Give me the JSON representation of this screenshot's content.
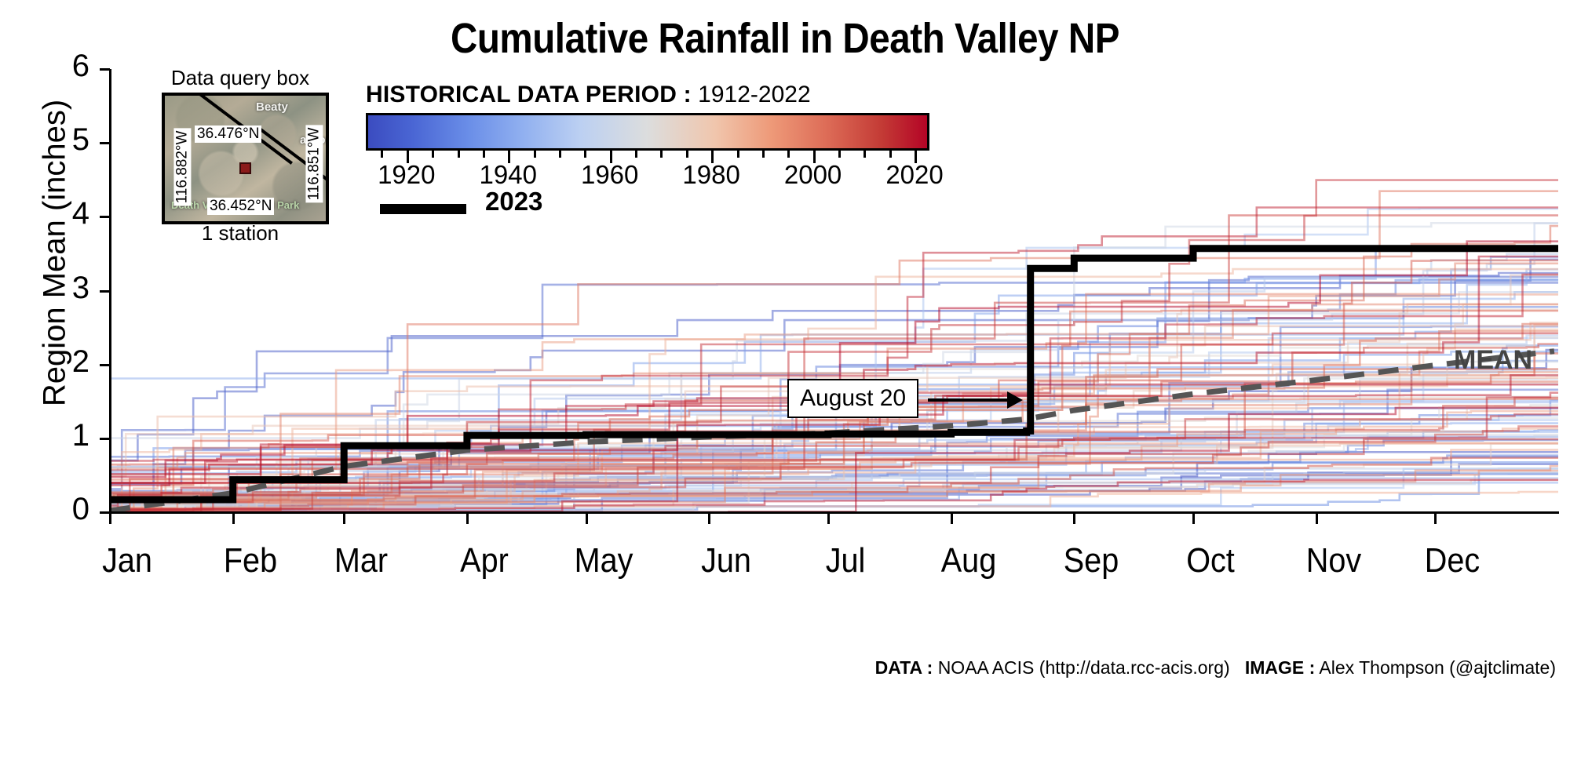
{
  "title": "Cumulative Rainfall in Death Valley NP",
  "axes": {
    "ylabel": "Region Mean (inches)",
    "yticks": [
      "0",
      "1",
      "2",
      "3",
      "4",
      "5",
      "6"
    ],
    "xticks": [
      "Jan",
      "Feb",
      "Mar",
      "Apr",
      "May",
      "Jun",
      "Jul",
      "Aug",
      "Sep",
      "Oct",
      "Nov",
      "Dec"
    ]
  },
  "inset": {
    "title": "Data query box",
    "caption": "1 station",
    "north_label": "36.476°N",
    "south_label": "36.452°N",
    "west_label": "116.882°W",
    "east_label": "116.851°W",
    "places": [
      "Beaty",
      "argosa"
    ],
    "park_label": "Death Valley National Park"
  },
  "legend": {
    "colorbar_title": "HISTORICAL DATA PERIOD :",
    "period": "1912-2022",
    "ticks": [
      "1920",
      "1940",
      "1960",
      "1980",
      "2000",
      "2020"
    ],
    "current_year_label": "2023",
    "mean_label": "MEAN"
  },
  "annotation": {
    "label": "August 20"
  },
  "attribution": {
    "data_key": "DATA :",
    "data_value": "NOAA ACIS (http://data.rcc-acis.org)",
    "image_key": "IMAGE :",
    "image_value": "Alex Thompson (@ajtclimate)"
  },
  "colors": {
    "cold": "#3b4cc0",
    "warm": "#b40426",
    "current": "#000000",
    "mean": "#555555"
  },
  "chart_data": {
    "type": "line",
    "title": "Cumulative Rainfall in Death Valley NP",
    "xlabel": "",
    "ylabel": "Region Mean (inches)",
    "xlim": [
      "Jan 1",
      "Dec 31"
    ],
    "ylim": [
      0,
      6
    ],
    "grid": false,
    "legend_position": "upper-left",
    "x": [
      "Jan 1",
      "Feb 1",
      "Mar 1",
      "Apr 1",
      "May 1",
      "Jun 1",
      "Jul 1",
      "Aug 1",
      "Aug 20",
      "Aug 21",
      "Sep 1",
      "Oct 1",
      "Nov 1",
      "Dec 1",
      "Dec 31"
    ],
    "series": [
      {
        "name": "2023",
        "color": "#000000",
        "style": "solid-step",
        "values": [
          0.17,
          0.44,
          0.9,
          1.04,
          1.05,
          1.05,
          1.06,
          1.08,
          1.1,
          3.3,
          3.44,
          3.57,
          3.57,
          3.57,
          3.57
        ]
      },
      {
        "name": "MEAN",
        "color": "#555555",
        "style": "dashed",
        "values": [
          0.02,
          0.26,
          0.62,
          0.84,
          0.95,
          1.02,
          1.07,
          1.17,
          1.26,
          1.27,
          1.38,
          1.6,
          1.79,
          1.99,
          2.18
        ]
      }
    ],
    "historical": {
      "description": "110 thin semi-transparent cumulative-rainfall step traces, one per year 1912-2022, colored blue (early years) through red (recent years) by the coolwarm colormap",
      "year_range": [
        1912,
        2022
      ],
      "count": 111,
      "end_of_year_min": 0.2,
      "end_of_year_max": 4.7
    }
  }
}
